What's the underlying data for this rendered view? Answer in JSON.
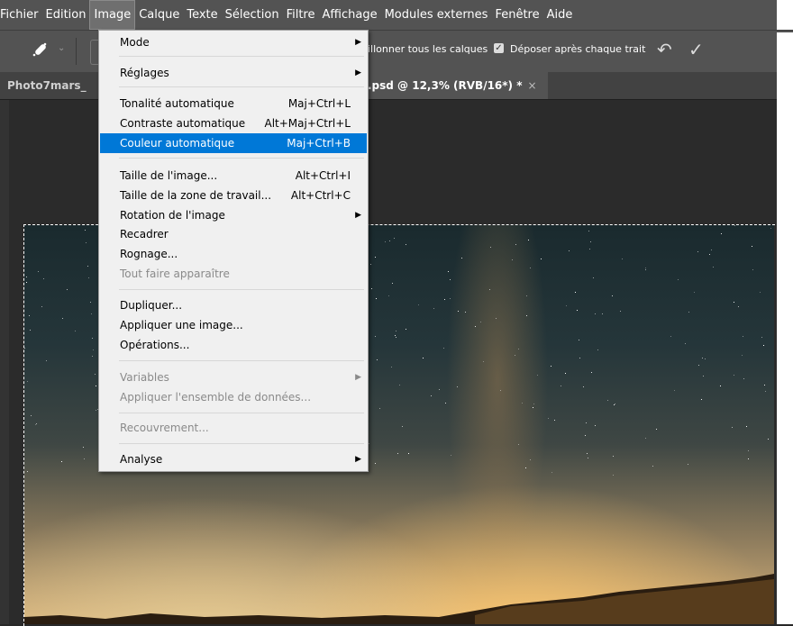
{
  "menubar": {
    "items": [
      "Fichier",
      "Edition",
      "Image",
      "Calque",
      "Texte",
      "Sélection",
      "Filtre",
      "Affichage",
      "Modules externes",
      "Fenêtre",
      "Aide"
    ]
  },
  "optionsbar": {
    "sample_all_layers": "illonner tous les calques",
    "drop_after_stroke": "Déposer après chaque trait",
    "check_glyph": "✓",
    "checkmark_glyph": "✓",
    "undo_glyph": "↶"
  },
  "tabs": {
    "first": "Photo7mars_",
    "active": ".psd @ 12,3% (RVB/16*) *",
    "close": "×"
  },
  "image_menu": {
    "items": [
      {
        "label": "Mode",
        "submenu": true
      },
      {
        "label": "Réglages",
        "submenu": true
      },
      {
        "label": "Tonalité automatique",
        "shortcut": "Maj+Ctrl+L"
      },
      {
        "label": "Contraste automatique",
        "shortcut": "Alt+Maj+Ctrl+L"
      },
      {
        "label": "Couleur automatique",
        "shortcut": "Maj+Ctrl+B",
        "highlighted": true
      },
      {
        "label": "Taille de l'image...",
        "shortcut": "Alt+Ctrl+I"
      },
      {
        "label": "Taille de la zone de travail...",
        "shortcut": "Alt+Ctrl+C"
      },
      {
        "label": "Rotation de l'image",
        "submenu": true
      },
      {
        "label": "Recadrer"
      },
      {
        "label": "Rognage..."
      },
      {
        "label": "Tout faire apparaître",
        "disabled": true
      },
      {
        "label": "Dupliquer..."
      },
      {
        "label": "Appliquer une image..."
      },
      {
        "label": "Opérations..."
      },
      {
        "label": "Variables",
        "submenu": true,
        "disabled": true
      },
      {
        "label": "Appliquer l'ensemble de données...",
        "disabled": true
      },
      {
        "label": "Recouvrement...",
        "disabled": true
      },
      {
        "label": "Analyse",
        "submenu": true
      }
    ],
    "arrow_glyph": "▶"
  },
  "colors": {
    "highlight": "#0078d7",
    "menu_bg": "#f0f0f0",
    "app_bg": "#535353"
  }
}
